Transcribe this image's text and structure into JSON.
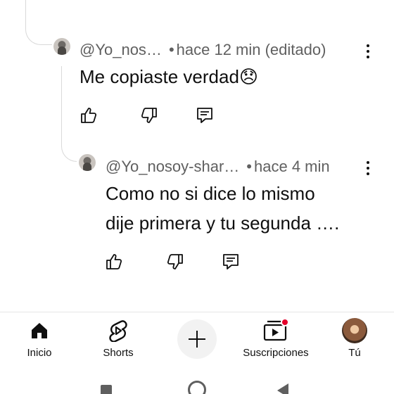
{
  "comments": [
    {
      "author": "@Yo_nos…",
      "separator": "•",
      "time": "hace 12 min (editado)",
      "text": "Me copiaste verdad😞",
      "avatar_icon": "user-avatar",
      "actions": {
        "like_icon": "thumb-up-icon",
        "dislike_icon": "thumb-down-icon",
        "reply_icon": "reply-icon",
        "menu_icon": "more-vert-icon"
      }
    },
    {
      "author": "@Yo_nosoy-shar…",
      "separator": "•",
      "time": "hace 4 min",
      "text_lines": [
        "Como no si dice lo mismo",
        "dije primera y tu segunda …."
      ],
      "avatar_icon": "user-avatar",
      "actions": {
        "like_icon": "thumb-up-icon",
        "dislike_icon": "thumb-down-icon",
        "reply_icon": "reply-icon",
        "menu_icon": "more-vert-icon"
      }
    }
  ],
  "bottom_nav": {
    "items": [
      {
        "label": "Inicio",
        "icon": "home-icon",
        "active": true
      },
      {
        "label": "Shorts",
        "icon": "shorts-icon"
      },
      {
        "label": "",
        "icon": "create-plus-icon"
      },
      {
        "label": "Suscripciones",
        "icon": "subscriptions-icon",
        "badge_color": "#e4002b"
      },
      {
        "label": "Tú",
        "icon": "profile-avatar"
      }
    ]
  },
  "system_nav": {
    "recents_icon": "recents-square-icon",
    "home_icon": "home-circle-icon",
    "back_icon": "back-triangle-icon"
  },
  "colors": {
    "text_primary": "#0f0f0f",
    "text_secondary": "#606060",
    "thread_line": "#d9d9d9",
    "badge": "#e4002b"
  }
}
